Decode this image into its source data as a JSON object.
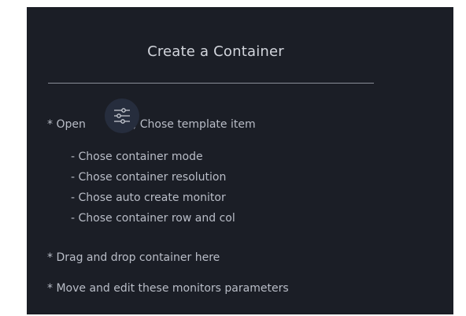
{
  "dialog": {
    "title": "Create a Container",
    "open_prefix": "* Open",
    "open_suffix": ", Chose template item",
    "template_icon": "sliders-icon",
    "steps": [
      "- Chose container mode",
      "- Chose container resolution",
      "- Chose auto create monitor",
      "- Chose container row and col"
    ],
    "drag_text": "* Drag and drop container here",
    "move_text": "* Move and edit these monitors parameters"
  },
  "colors": {
    "panel_background": "#1b1e26",
    "text": "#b9bdc7",
    "icon_button": "#262d3d"
  }
}
